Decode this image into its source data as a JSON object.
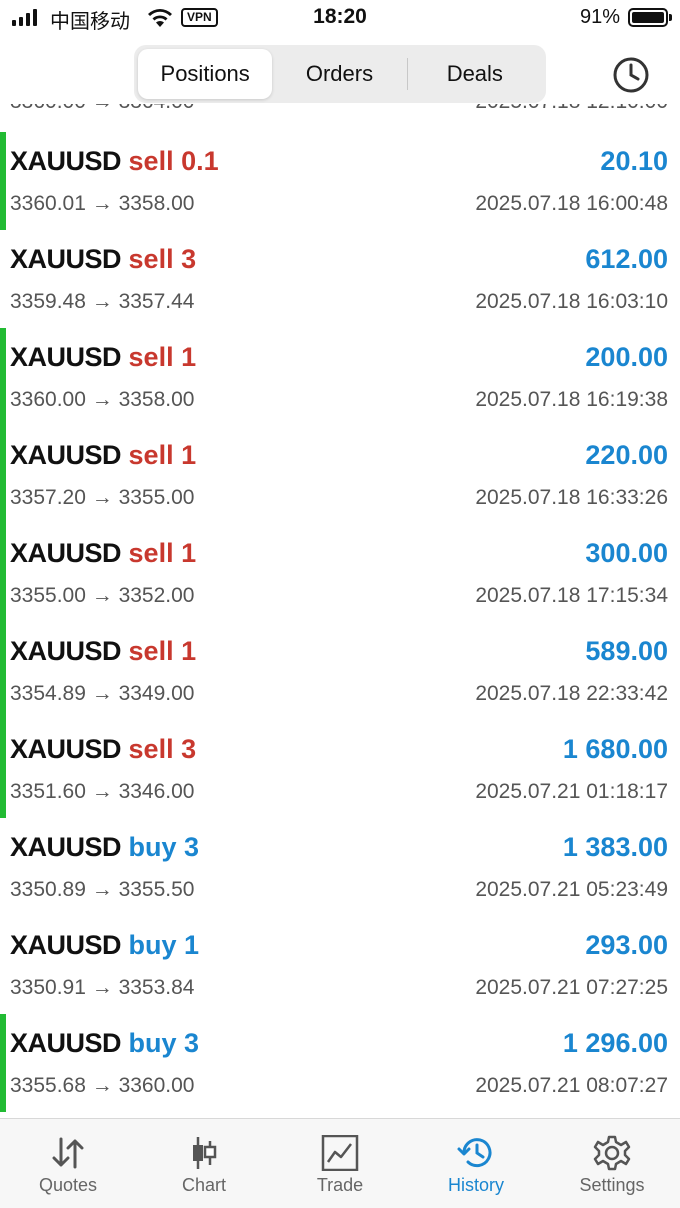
{
  "status_bar": {
    "carrier": "中国移动",
    "vpn": "VPN",
    "time": "18:20",
    "battery": "91%"
  },
  "segments": {
    "positions": "Positions",
    "orders": "Orders",
    "deals": "Deals",
    "active": "Positions"
  },
  "colors": {
    "sell": "#c8382e",
    "buy": "#1a86d0",
    "profit": "#1a86d0",
    "marker": "#22bb33"
  },
  "rows": [
    {
      "symbol": "XAUUSD",
      "side": "sell 0.1",
      "type": "sell",
      "profit": "20.10",
      "prices": "3360.01 → 3358.00",
      "time": "2025.07.18 16:00:48",
      "marker": true
    },
    {
      "symbol": "XAUUSD",
      "side": "sell 3",
      "type": "sell",
      "profit": "612.00",
      "prices": "3359.48 → 3357.44",
      "time": "2025.07.18 16:03:10",
      "marker": false
    },
    {
      "symbol": "XAUUSD",
      "side": "sell 1",
      "type": "sell",
      "profit": "200.00",
      "prices": "3360.00 → 3358.00",
      "time": "2025.07.18 16:19:38",
      "marker": true
    },
    {
      "symbol": "XAUUSD",
      "side": "sell 1",
      "type": "sell",
      "profit": "220.00",
      "prices": "3357.20 → 3355.00",
      "time": "2025.07.18 16:33:26",
      "marker": true
    },
    {
      "symbol": "XAUUSD",
      "side": "sell 1",
      "type": "sell",
      "profit": "300.00",
      "prices": "3355.00 → 3352.00",
      "time": "2025.07.18 17:15:34",
      "marker": true
    },
    {
      "symbol": "XAUUSD",
      "side": "sell 1",
      "type": "sell",
      "profit": "589.00",
      "prices": "3354.89 → 3349.00",
      "time": "2025.07.18 22:33:42",
      "marker": true
    },
    {
      "symbol": "XAUUSD",
      "side": "sell 3",
      "type": "sell",
      "profit": "1 680.00",
      "prices": "3351.60 → 3346.00",
      "time": "2025.07.21 01:18:17",
      "marker": true
    },
    {
      "symbol": "XAUUSD",
      "side": "buy 3",
      "type": "buy",
      "profit": "1 383.00",
      "prices": "3350.89 → 3355.50",
      "time": "2025.07.21 05:23:49",
      "marker": false
    },
    {
      "symbol": "XAUUSD",
      "side": "buy 1",
      "type": "buy",
      "profit": "293.00",
      "prices": "3350.91 → 3353.84",
      "time": "2025.07.21 07:27:25",
      "marker": false
    },
    {
      "symbol": "XAUUSD",
      "side": "buy 3",
      "type": "buy",
      "profit": "1 296.00",
      "prices": "3355.68 → 3360.00",
      "time": "2025.07.21 08:07:27",
      "marker": true
    }
  ],
  "tabs": [
    {
      "label": "Quotes",
      "icon": "quotes-icon"
    },
    {
      "label": "Chart",
      "icon": "chart-icon"
    },
    {
      "label": "Trade",
      "icon": "trade-icon"
    },
    {
      "label": "History",
      "icon": "history-icon",
      "active": true
    },
    {
      "label": "Settings",
      "icon": "settings-icon"
    }
  ]
}
